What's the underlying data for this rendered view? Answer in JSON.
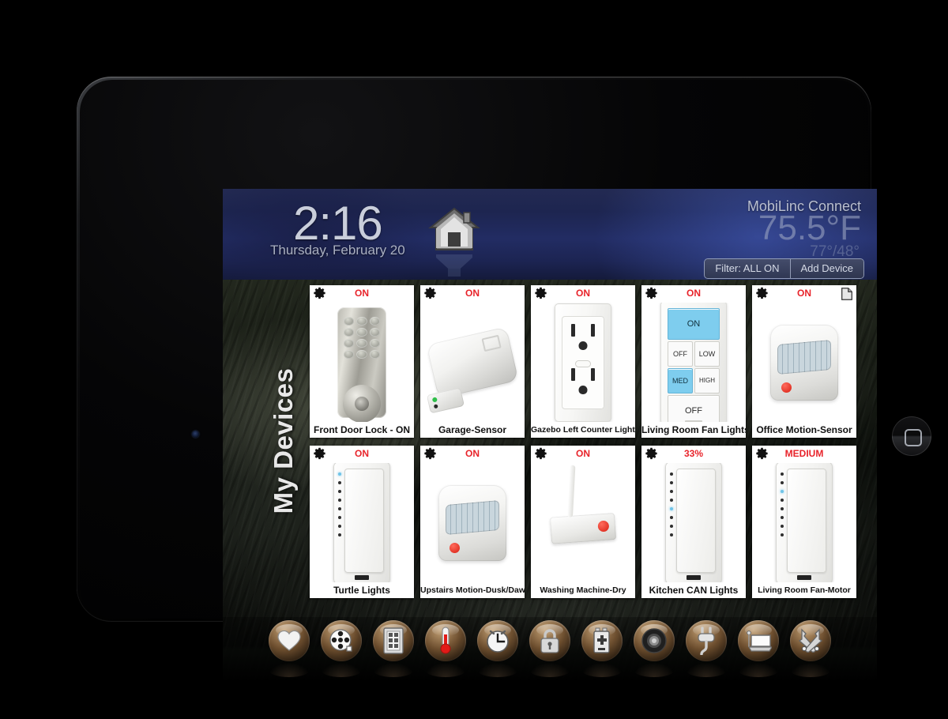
{
  "header": {
    "clock_time": "2:16",
    "clock_date": "Thursday, February 20",
    "app_title": "MobiLinc Connect",
    "temp_current": "75.5°F",
    "temp_high_low": "77°/48°",
    "house_icon": "home-icon",
    "filter_button": "Filter: ALL ON",
    "add_device_button": "Add Device"
  },
  "section": {
    "side_label": "My Devices"
  },
  "devices": [
    {
      "name": "Front Door Lock - ON",
      "state": "ON",
      "art": "deadbolt-lock",
      "gear": "gear-icon",
      "page_icon": null
    },
    {
      "name": "Garage-Sensor",
      "state": "ON",
      "art": "garage-sensor",
      "gear": "gear-icon",
      "page_icon": null
    },
    {
      "name": "Gazebo Left Counter Lights",
      "state": "ON",
      "art": "wall-outlet",
      "gear": "gear-icon",
      "page_icon": null
    },
    {
      "name": "Living Room Fan Lights",
      "state": "ON",
      "art": "fan-keypad",
      "gear": "gear-icon",
      "page_icon": null,
      "keypad": {
        "top": "ON",
        "mid_left": "OFF",
        "mid_right": "LOW",
        "low_left": "MED",
        "low_right": "HIGH",
        "bottom": "OFF",
        "active": [
          "ON",
          "MED"
        ],
        "active_color": "#7ecdee"
      }
    },
    {
      "name": "Office Motion-Sensor",
      "state": "ON",
      "art": "motion-sensor",
      "gear": "gear-icon",
      "page_icon": "page-icon"
    },
    {
      "name": "Turtle Lights",
      "state": "ON",
      "art": "dimmer-switch",
      "gear": "gear-icon",
      "page_icon": null,
      "led_lit_index": 0
    },
    {
      "name": "Upstairs Motion-Dusk/Dawn",
      "state": "ON",
      "art": "motion-sensor",
      "gear": "gear-icon",
      "page_icon": null
    },
    {
      "name": "Washing Machine-Dry",
      "state": "ON",
      "art": "washer-sensor",
      "gear": "gear-icon",
      "page_icon": null
    },
    {
      "name": "Kitchen CAN Lights",
      "state": "33%",
      "art": "dimmer-switch",
      "gear": "gear-icon",
      "page_icon": null,
      "led_lit_index": 4
    },
    {
      "name": "Living Room Fan-Motor",
      "state": "MEDIUM",
      "art": "dimmer-switch",
      "gear": "gear-icon",
      "page_icon": null,
      "led_lit_index": 2
    }
  ],
  "toolbar": [
    {
      "icon": "heart-icon",
      "glyph": "♥"
    },
    {
      "icon": "film-reel-icon",
      "glyph": "film"
    },
    {
      "icon": "keypad-icon",
      "glyph": "keypad"
    },
    {
      "icon": "thermometer-icon",
      "glyph": "thermo"
    },
    {
      "icon": "clock-icon",
      "glyph": "clock"
    },
    {
      "icon": "lock-icon",
      "glyph": "lock"
    },
    {
      "icon": "battery-plus-icon",
      "glyph": "battery"
    },
    {
      "icon": "speaker-icon",
      "glyph": "speaker"
    },
    {
      "icon": "power-plug-icon",
      "glyph": "plug"
    },
    {
      "icon": "laptop-icon",
      "glyph": "laptop"
    },
    {
      "icon": "tools-icon",
      "glyph": "tools"
    }
  ],
  "colors": {
    "state_red": "#e8232a",
    "keypad_active": "#7ecdee",
    "header_blue": "#222c63",
    "card_white": "#ffffff"
  }
}
